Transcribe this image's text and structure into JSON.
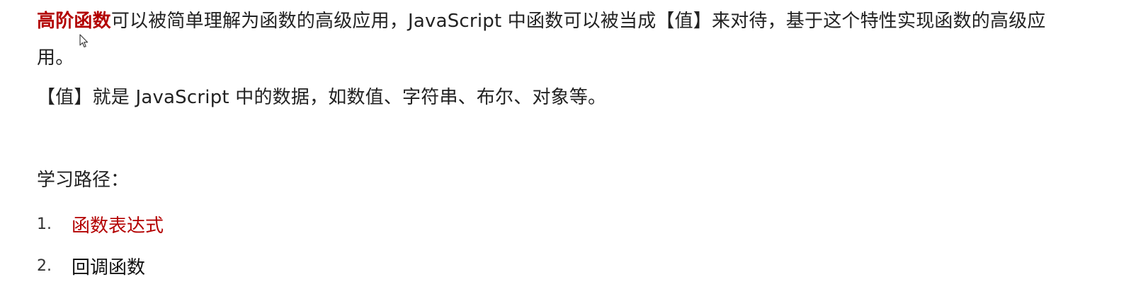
{
  "intro": {
    "term": "高阶函数",
    "text": "可以被简单理解为函数的高级应用，JavaScript 中函数可以被当成【值】来对待，基于这个特性实现函数的高级应用。"
  },
  "value_note": "【值】就是 JavaScript 中的数据，如数值、字符串、布尔、对象等。",
  "path": {
    "label": "学习路径：",
    "items": [
      {
        "num": "1.",
        "text": "函数表达式"
      },
      {
        "num": "2.",
        "text": "回调函数"
      }
    ]
  },
  "colors": {
    "accent": "#b30000",
    "text": "#222222"
  }
}
